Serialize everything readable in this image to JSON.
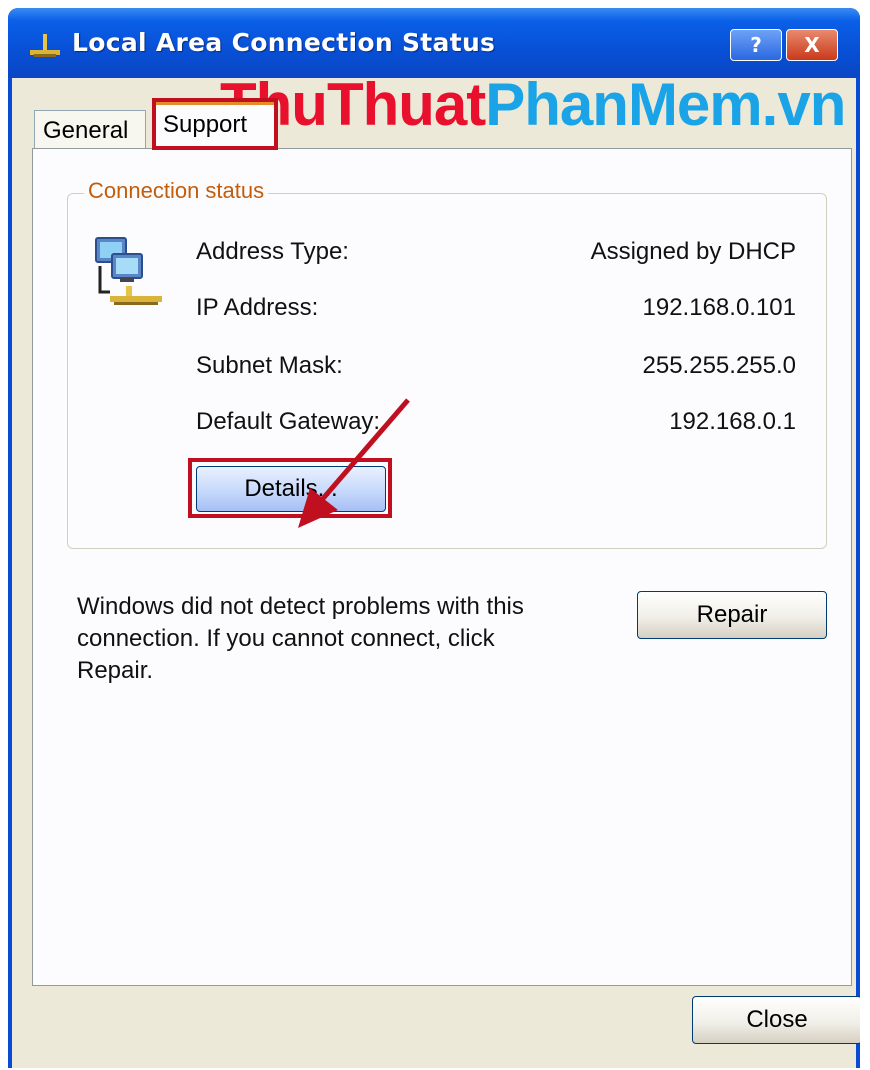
{
  "window": {
    "title": "Local Area Connection Status",
    "help_label": "?",
    "close_label": "X"
  },
  "watermark": {
    "part1": "ThuThuat",
    "part2": "PhanMem.vn"
  },
  "tabs": [
    {
      "label": "General"
    },
    {
      "label": "Support"
    }
  ],
  "connection_status": {
    "title": "Connection status",
    "rows": [
      {
        "label": "Address Type:",
        "value": "Assigned by DHCP"
      },
      {
        "label": "IP Address:",
        "value": "192.168.0.101"
      },
      {
        "label": "Subnet Mask:",
        "value": "255.255.255.0"
      },
      {
        "label": "Default Gateway:",
        "value": "192.168.0.1"
      }
    ],
    "details_label": "Details..."
  },
  "info_text": "Windows did not detect problems with this connection. If you cannot connect, click Repair.",
  "repair_label": "Repair",
  "close_label": "Close",
  "colors": {
    "highlight": "#c01020",
    "titlebar": "#0850d6",
    "group_title": "#c25d0c"
  },
  "icons": [
    "network-connection-icon",
    "network-computers-icon",
    "help-icon",
    "close-icon",
    "annotation-arrow-icon"
  ]
}
